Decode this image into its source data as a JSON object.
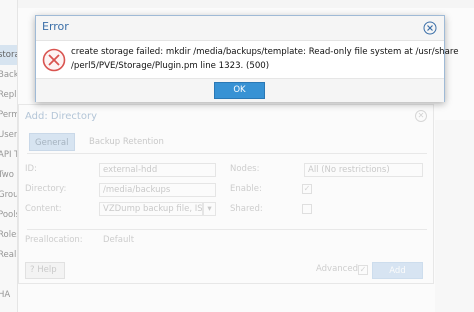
{
  "background": {
    "sidebar_items": [
      {
        "label": "",
        "active": false
      },
      {
        "label": "",
        "active": false
      },
      {
        "label": "storage",
        "active": true
      },
      {
        "label": "Backup",
        "active": false
      },
      {
        "label": "Replication",
        "active": false
      },
      {
        "label": "Permissions",
        "active": false
      },
      {
        "label": "Users",
        "active": false
      },
      {
        "label": "API Tokens",
        "active": false
      },
      {
        "label": "Two Factor",
        "active": false
      },
      {
        "label": "Groups",
        "active": false
      },
      {
        "label": "Pools",
        "active": false
      },
      {
        "label": "Roles",
        "active": false
      },
      {
        "label": "Realms",
        "active": false
      },
      {
        "label": "",
        "active": false
      },
      {
        "label": "HA",
        "active": false
      },
      {
        "label": "",
        "active": false
      }
    ]
  },
  "add_dialog": {
    "title": "Add: Directory",
    "tabs": [
      "General",
      "Backup Retention"
    ],
    "fields": {
      "id_label": "ID:",
      "id_value": "external-hdd",
      "directory_label": "Directory:",
      "directory_value": "/media/backups",
      "content_label": "Content:",
      "content_value": "VZDump backup file, IS",
      "nodes_label": "Nodes:",
      "nodes_value": "All (No restrictions)",
      "enable_label": "Enable:",
      "shared_label": "Shared:",
      "preallocation_label": "Preallocation:",
      "preallocation_value": "Default"
    },
    "help_label": "Help",
    "advanced_label": "Advanced",
    "add_label": "Add"
  },
  "error_dialog": {
    "title": "Error",
    "message": "create storage failed: mkdir /media/backups/template: Read-only file system at /usr/share\n/perl5/PVE/Storage/Plugin.pm line 1323. (500)",
    "ok_label": "OK"
  },
  "colors": {
    "accent": "#3892d4",
    "title_blue": "#3b6fa8",
    "error_red": "#d9534f"
  }
}
